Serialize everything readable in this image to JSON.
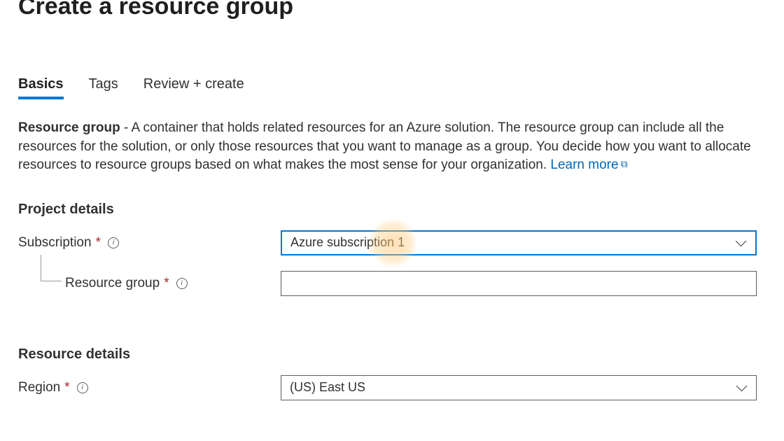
{
  "page": {
    "title": "Create a resource group"
  },
  "tabs": {
    "basics": "Basics",
    "tags": "Tags",
    "review": "Review + create"
  },
  "description": {
    "label": "Resource group",
    "text": " - A container that holds related resources for an Azure solution. The resource group can include all the resources for the solution, or only those resources that you want to manage as a group. You decide how you want to allocate resources to resource groups based on what makes the most sense for your organization. ",
    "learn_more": "Learn more"
  },
  "sections": {
    "project": "Project details",
    "resource": "Resource details"
  },
  "fields": {
    "subscription": {
      "label": "Subscription",
      "value": "Azure subscription 1"
    },
    "resource_group": {
      "label": "Resource group",
      "value": ""
    },
    "region": {
      "label": "Region",
      "value": "(US) East US"
    }
  }
}
